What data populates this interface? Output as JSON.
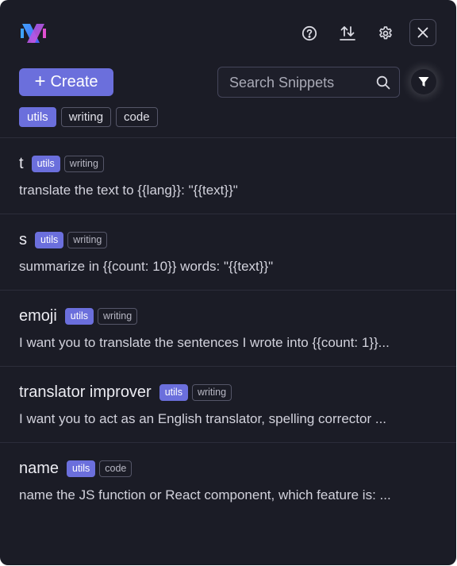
{
  "header": {
    "logo_icon": "x-logo-icon",
    "actions": [
      {
        "name": "help",
        "icon": "question-circle-icon"
      },
      {
        "name": "import-export",
        "icon": "arrows-up-down-icon"
      },
      {
        "name": "settings",
        "icon": "gear-icon"
      },
      {
        "name": "close",
        "icon": "close-icon"
      }
    ]
  },
  "toolbar": {
    "create_label": "Create",
    "create_icon": "+",
    "search_placeholder": "Search Snippets",
    "filter_icon": "filter-icon"
  },
  "filter_tags": [
    {
      "label": "utils",
      "active": true
    },
    {
      "label": "writing",
      "active": false
    },
    {
      "label": "code",
      "active": false
    }
  ],
  "snippets": [
    {
      "title": "t",
      "tags": [
        "utils",
        "writing"
      ],
      "body": "translate the text to {{lang}}: \"{{text}}\""
    },
    {
      "title": "s",
      "tags": [
        "utils",
        "writing"
      ],
      "body": "summarize in {{count: 10}} words: \"{{text}}\""
    },
    {
      "title": "emoji",
      "tags": [
        "utils",
        "writing"
      ],
      "body": "I want you to translate the sentences I wrote into {{count: 1}}..."
    },
    {
      "title": "translator improver",
      "tags": [
        "utils",
        "writing"
      ],
      "body": "I want you to act as an English translator, spelling corrector ..."
    },
    {
      "title": "name",
      "tags": [
        "utils",
        "code"
      ],
      "body": "name the JS function or React component, which feature is: ..."
    }
  ],
  "colors": {
    "background": "#1b1c26",
    "accent": "#6b6fdc",
    "border": "#2c2d3a"
  }
}
